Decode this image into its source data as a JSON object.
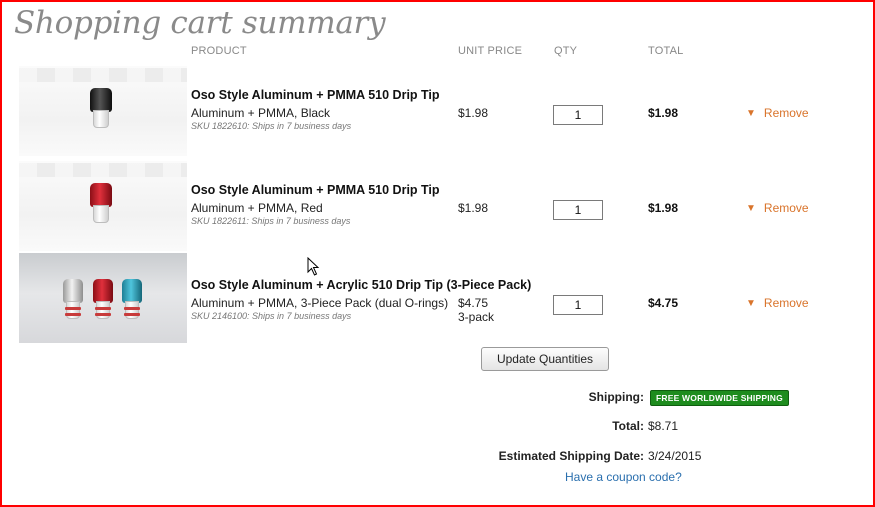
{
  "page": {
    "title": "Shopping cart summary"
  },
  "columns": {
    "product": "PRODUCT",
    "unit_price": "UNIT PRICE",
    "qty": "QTY",
    "total": "TOTAL"
  },
  "items": [
    {
      "name": "Oso Style Aluminum + PMMA 510 Drip Tip",
      "variant": "Aluminum + PMMA, Black",
      "sku": "SKU 1822610: Ships in 7 business days",
      "unit_price": "$1.98",
      "unit_note": "",
      "qty": "1",
      "total": "$1.98",
      "remove_label": "Remove",
      "image_icon": "drip-tip-black-image"
    },
    {
      "name": "Oso Style Aluminum + PMMA 510 Drip Tip",
      "variant": "Aluminum + PMMA, Red",
      "sku": "SKU 1822611: Ships in 7 business days",
      "unit_price": "$1.98",
      "unit_note": "",
      "qty": "1",
      "total": "$1.98",
      "remove_label": "Remove",
      "image_icon": "drip-tip-red-image"
    },
    {
      "name": "Oso Style Aluminum + Acrylic 510 Drip Tip (3-Piece Pack)",
      "variant": "Aluminum + PMMA, 3-Piece Pack (dual O-rings)",
      "sku": "SKU 2146100: Ships in 7 business days",
      "unit_price": "$4.75",
      "unit_note": "3-pack",
      "qty": "1",
      "total": "$4.75",
      "remove_label": "Remove",
      "image_icon": "drip-tip-3-pack-image"
    }
  ],
  "actions": {
    "update_label": "Update Quantities"
  },
  "summary": {
    "shipping_label": "Shipping:",
    "shipping_badge": "FREE WORLDWIDE SHIPPING",
    "total_label": "Total:",
    "total_value": "$8.71",
    "est_label": "Estimated Shipping Date:",
    "est_value": "3/24/2015",
    "coupon_link": "Have a coupon code?"
  },
  "colors": {
    "frame": "#ff0000",
    "remove": "#d9742b",
    "badge": "#1e8c1e",
    "link": "#2a6fae"
  }
}
